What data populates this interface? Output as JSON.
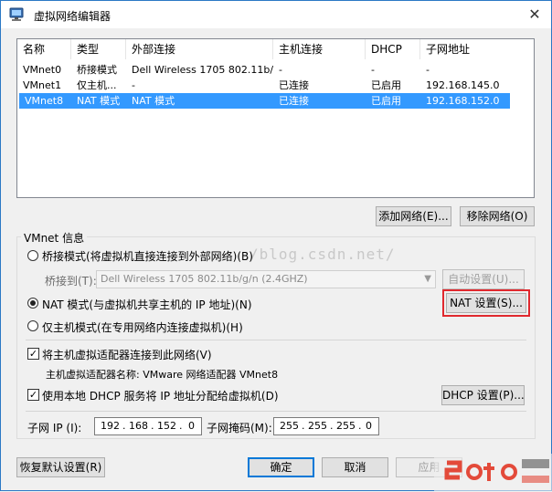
{
  "window": {
    "title": "虚拟网络编辑器",
    "close": "✕"
  },
  "list": {
    "headers": [
      "名称",
      "类型",
      "外部连接",
      "主机连接",
      "DHCP",
      "子网地址"
    ],
    "rows": [
      {
        "name": "VMnet0",
        "type": "桥接模式",
        "external": "Dell Wireless 1705 802.11b/...",
        "host": "-",
        "dhcp": "-",
        "subnet": "-",
        "selected": false
      },
      {
        "name": "VMnet1",
        "type": "仅主机...",
        "external": "-",
        "host": "已连接",
        "dhcp": "已启用",
        "subnet": "192.168.145.0",
        "selected": false
      },
      {
        "name": "VMnet8",
        "type": "NAT 模式",
        "external": "NAT 模式",
        "host": "已连接",
        "dhcp": "已启用",
        "subnet": "192.168.152.0",
        "selected": true
      }
    ]
  },
  "list_buttons": {
    "add": "添加网络(E)...",
    "remove": "移除网络(O)"
  },
  "vmnet_info": {
    "legend": "VMnet 信息",
    "bridge_radio": "桥接模式(将虚拟机直接连接到外部网络)(B)",
    "bridge_to_label": "桥接到(T):",
    "bridge_to_value": "Dell Wireless 1705 802.11b/g/n (2.4GHZ)",
    "auto_settings": "自动设置(U)...",
    "nat_radio": "NAT 模式(与虚拟机共享主机的 IP 地址)(N)",
    "nat_settings": "NAT 设置(S)...",
    "hostonly_radio": "仅主机模式(在专用网络内连接虚拟机)(H)",
    "connect_adapter_check": "将主机虚拟适配器连接到此网络(V)",
    "adapter_name": "主机虚拟适配器名称: VMware 网络适配器 VMnet8",
    "dhcp_check": "使用本地 DHCP 服务将 IP 地址分配给虚拟机(D)",
    "dhcp_settings": "DHCP 设置(P)...",
    "subnet_ip_label": "子网 IP (I):",
    "subnet_ip": [
      "192",
      "168",
      "152",
      "0"
    ],
    "subnet_mask_label": "子网掩码(M):",
    "subnet_mask": [
      "255",
      "255",
      "255",
      "0"
    ]
  },
  "footer": {
    "restore": "恢复默认设置(R)",
    "ok": "确定",
    "cancel": "取消",
    "apply": "应用"
  },
  "watermark": "/blog.csdn.net/",
  "accent_colors": {
    "selection": "#3399ff",
    "highlight": "#e0282e"
  }
}
